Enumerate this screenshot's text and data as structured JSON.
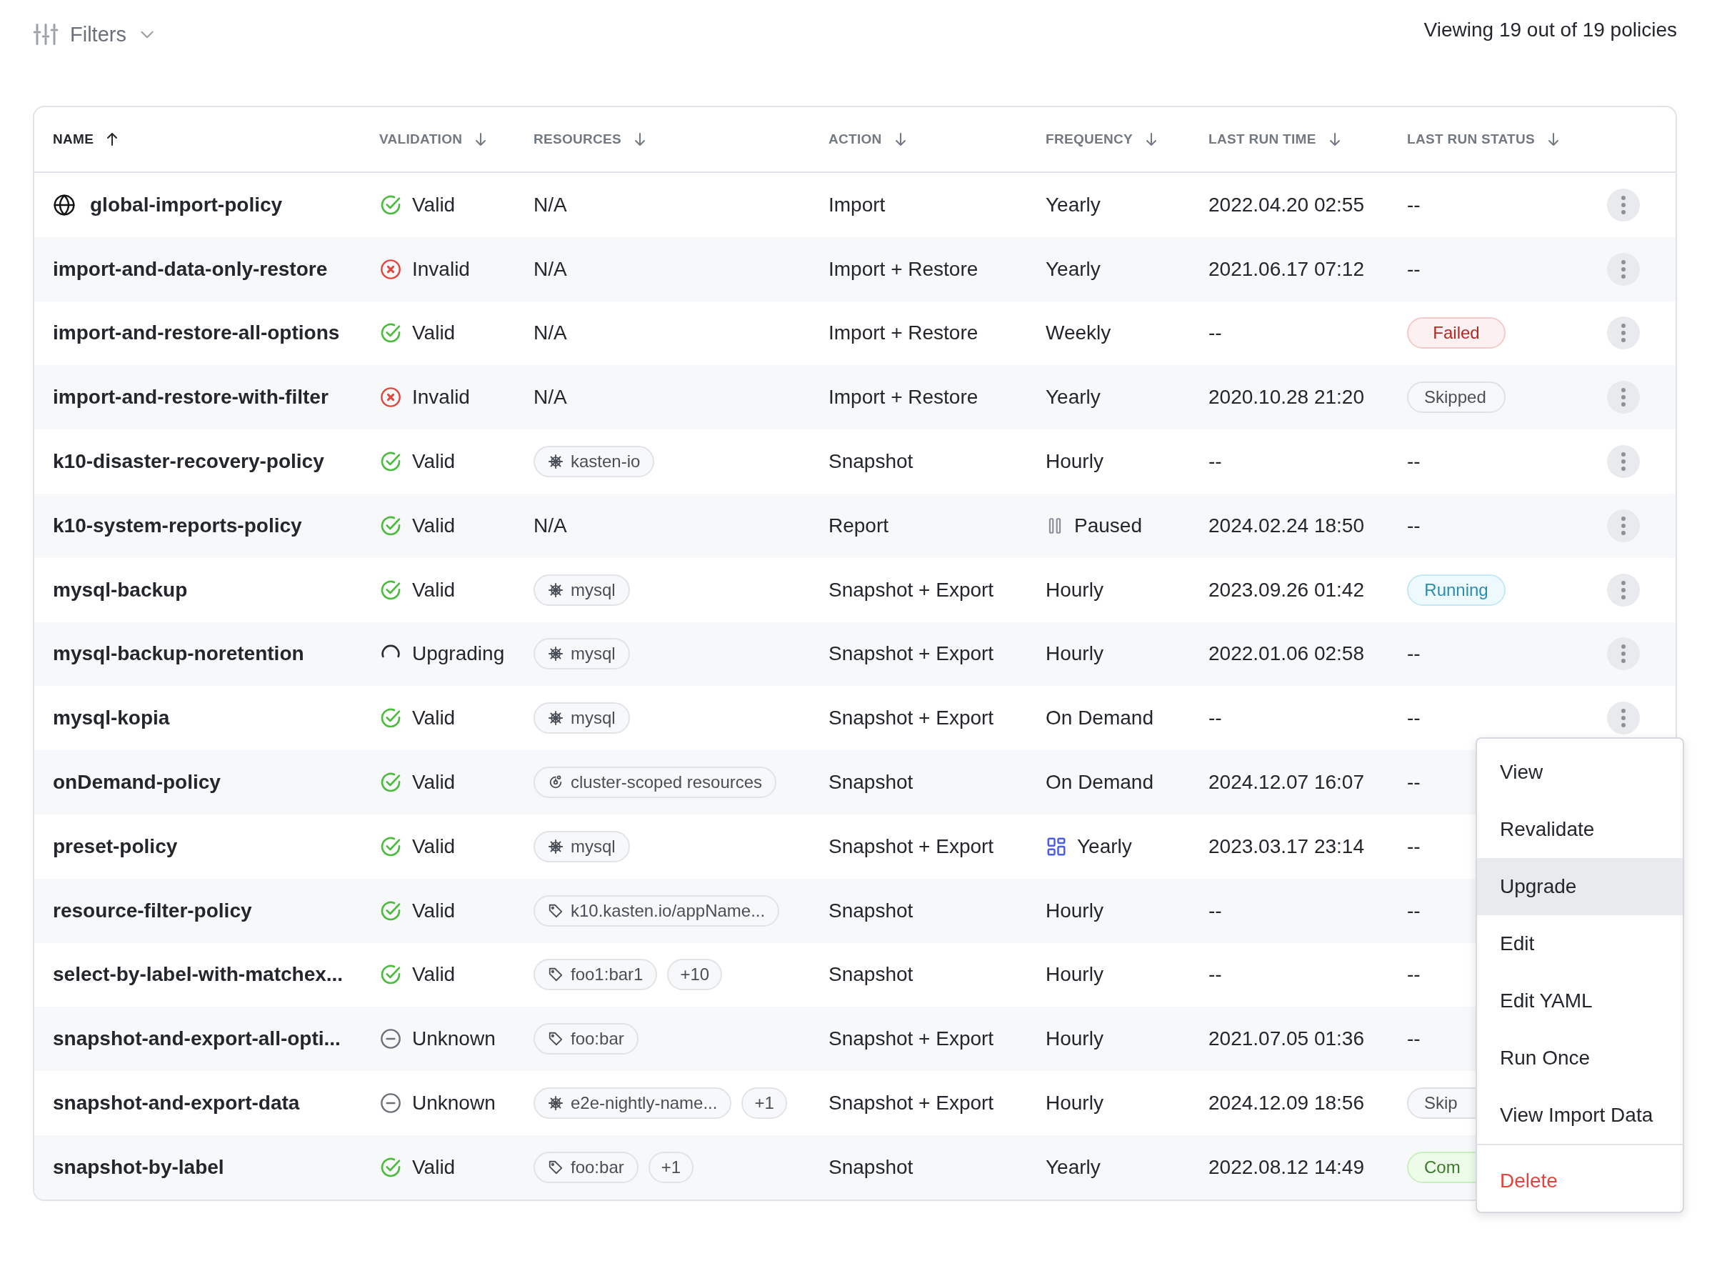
{
  "toolbar": {
    "filter_label": "Filters",
    "summary": "Viewing 19 out of 19 policies"
  },
  "table": {
    "columns": [
      {
        "label": "NAME",
        "selected": true,
        "ascending": true
      },
      {
        "label": "VALIDATION",
        "selected": false,
        "ascending": false
      },
      {
        "label": "RESOURCES",
        "selected": false,
        "ascending": false
      },
      {
        "label": "ACTION",
        "selected": false,
        "ascending": false
      },
      {
        "label": "FREQUENCY",
        "selected": false,
        "ascending": false
      },
      {
        "label": "LAST RUN TIME",
        "selected": false,
        "ascending": false
      },
      {
        "label": "LAST RUN STATUS",
        "selected": false,
        "ascending": false
      }
    ],
    "rows": [
      {
        "name": "global-import-policy",
        "global": true,
        "validation": {
          "kind": "valid",
          "text": "Valid"
        },
        "resources_text": "N/A",
        "action": "Import",
        "frequency": {
          "kind": "plain",
          "text": "Yearly"
        },
        "last_run_time": "2022.04.20 02:55",
        "last_run_status": {
          "kind": "none",
          "text": "--"
        },
        "more_button": true
      },
      {
        "name": "import-and-data-only-restore",
        "global": false,
        "validation": {
          "kind": "invalid",
          "text": "Invalid"
        },
        "resources_text": "N/A",
        "action": "Import + Restore",
        "frequency": {
          "kind": "plain",
          "text": "Yearly"
        },
        "last_run_time": "2021.06.17 07:12",
        "last_run_status": {
          "kind": "none",
          "text": "--"
        },
        "more_button": true
      },
      {
        "name": "import-and-restore-all-options",
        "global": false,
        "validation": {
          "kind": "valid",
          "text": "Valid"
        },
        "resources_text": "N/A",
        "action": "Import + Restore",
        "frequency": {
          "kind": "plain",
          "text": "Weekly"
        },
        "last_run_time": "--",
        "last_run_status": {
          "kind": "failed",
          "text": "Failed"
        },
        "more_button": true
      },
      {
        "name": "import-and-restore-with-filter",
        "global": false,
        "validation": {
          "kind": "invalid",
          "text": "Invalid"
        },
        "resources_text": "N/A",
        "action": "Import + Restore",
        "frequency": {
          "kind": "plain",
          "text": "Yearly"
        },
        "last_run_time": "2020.10.28 21:20",
        "last_run_status": {
          "kind": "skipped",
          "text": "Skipped"
        },
        "more_button": true
      },
      {
        "name": "k10-disaster-recovery-policy",
        "global": false,
        "validation": {
          "kind": "valid",
          "text": "Valid"
        },
        "resources": [
          {
            "kind": "namespace",
            "text": "kasten-io"
          }
        ],
        "action": "Snapshot",
        "frequency": {
          "kind": "plain",
          "text": "Hourly"
        },
        "last_run_time": "--",
        "last_run_status": {
          "kind": "none",
          "text": "--"
        },
        "more_button": true
      },
      {
        "name": "k10-system-reports-policy",
        "global": false,
        "validation": {
          "kind": "valid",
          "text": "Valid"
        },
        "resources_text": "N/A",
        "action": "Report",
        "frequency": {
          "kind": "paused",
          "text": "Paused"
        },
        "last_run_time": "2024.02.24 18:50",
        "last_run_status": {
          "kind": "none",
          "text": "--"
        },
        "more_button": true
      },
      {
        "name": "mysql-backup",
        "global": false,
        "validation": {
          "kind": "valid",
          "text": "Valid"
        },
        "resources": [
          {
            "kind": "namespace",
            "text": "mysql"
          }
        ],
        "action": "Snapshot + Export",
        "frequency": {
          "kind": "plain",
          "text": "Hourly"
        },
        "last_run_time": "2023.09.26 01:42",
        "last_run_status": {
          "kind": "running",
          "text": "Running"
        },
        "more_button": true
      },
      {
        "name": "mysql-backup-noretention",
        "global": false,
        "validation": {
          "kind": "upgrading",
          "text": "Upgrading"
        },
        "resources": [
          {
            "kind": "namespace",
            "text": "mysql"
          }
        ],
        "action": "Snapshot + Export",
        "frequency": {
          "kind": "plain",
          "text": "Hourly"
        },
        "last_run_time": "2022.01.06 02:58",
        "last_run_status": {
          "kind": "none",
          "text": "--"
        },
        "more_button": true
      },
      {
        "name": "mysql-kopia",
        "global": false,
        "validation": {
          "kind": "valid",
          "text": "Valid"
        },
        "resources": [
          {
            "kind": "namespace",
            "text": "mysql"
          }
        ],
        "action": "Snapshot + Export",
        "frequency": {
          "kind": "plain",
          "text": "On Demand"
        },
        "last_run_time": "--",
        "last_run_status": {
          "kind": "none",
          "text": "--"
        },
        "more_button": true
      },
      {
        "name": "onDemand-policy",
        "global": false,
        "validation": {
          "kind": "valid",
          "text": "Valid"
        },
        "resources": [
          {
            "kind": "cluster",
            "text": "cluster-scoped resources"
          }
        ],
        "action": "Snapshot",
        "frequency": {
          "kind": "plain",
          "text": "On Demand"
        },
        "last_run_time": "2024.12.07 16:07",
        "last_run_status": {
          "kind": "none",
          "text": "--"
        },
        "more_button": false
      },
      {
        "name": "preset-policy",
        "global": false,
        "validation": {
          "kind": "valid",
          "text": "Valid"
        },
        "resources": [
          {
            "kind": "namespace",
            "text": "mysql"
          }
        ],
        "action": "Snapshot + Export",
        "frequency": {
          "kind": "preset",
          "text": "Yearly"
        },
        "last_run_time": "2023.03.17 23:14",
        "last_run_status": {
          "kind": "none",
          "text": "--"
        },
        "more_button": false
      },
      {
        "name": "resource-filter-policy",
        "global": false,
        "validation": {
          "kind": "valid",
          "text": "Valid"
        },
        "resources": [
          {
            "kind": "label",
            "text": "k10.kasten.io/appName..."
          }
        ],
        "action": "Snapshot",
        "frequency": {
          "kind": "plain",
          "text": "Hourly"
        },
        "last_run_time": "--",
        "last_run_status": {
          "kind": "none",
          "text": "--"
        },
        "more_button": false
      },
      {
        "name": "select-by-label-with-matchex...",
        "global": false,
        "validation": {
          "kind": "valid",
          "text": "Valid"
        },
        "resources": [
          {
            "kind": "label",
            "text": "foo1:bar1"
          },
          {
            "kind": "count",
            "text": "+10"
          }
        ],
        "action": "Snapshot",
        "frequency": {
          "kind": "plain",
          "text": "Hourly"
        },
        "last_run_time": "--",
        "last_run_status": {
          "kind": "none",
          "text": "--"
        },
        "more_button": false
      },
      {
        "name": "snapshot-and-export-all-opti...",
        "global": false,
        "validation": {
          "kind": "unknown",
          "text": "Unknown"
        },
        "resources": [
          {
            "kind": "label",
            "text": "foo:bar"
          }
        ],
        "action": "Snapshot + Export",
        "frequency": {
          "kind": "plain",
          "text": "Hourly"
        },
        "last_run_time": "2021.07.05 01:36",
        "last_run_status": {
          "kind": "none",
          "text": "--"
        },
        "more_button": false
      },
      {
        "name": "snapshot-and-export-data",
        "global": false,
        "validation": {
          "kind": "unknown",
          "text": "Unknown"
        },
        "resources": [
          {
            "kind": "namespace",
            "text": "e2e-nightly-name..."
          },
          {
            "kind": "count",
            "text": "+1"
          }
        ],
        "action": "Snapshot + Export",
        "frequency": {
          "kind": "plain",
          "text": "Hourly"
        },
        "last_run_time": "2024.12.09 18:56",
        "last_run_status": {
          "kind": "skipped",
          "text": "Skip"
        },
        "more_button": false
      },
      {
        "name": "snapshot-by-label",
        "global": false,
        "validation": {
          "kind": "valid",
          "text": "Valid"
        },
        "resources": [
          {
            "kind": "label",
            "text": "foo:bar"
          },
          {
            "kind": "count",
            "text": "+1"
          }
        ],
        "action": "Snapshot",
        "frequency": {
          "kind": "plain",
          "text": "Yearly"
        },
        "last_run_time": "2022.08.12 14:49",
        "last_run_status": {
          "kind": "completed",
          "text": "Com"
        },
        "more_button": false
      }
    ]
  },
  "context_menu": {
    "items": [
      {
        "label": "View",
        "kind": "normal",
        "selected": false
      },
      {
        "label": "Revalidate",
        "kind": "normal",
        "selected": false
      },
      {
        "label": "Upgrade",
        "kind": "normal",
        "selected": true
      },
      {
        "label": "Edit",
        "kind": "normal",
        "selected": false
      },
      {
        "label": "Edit YAML",
        "kind": "normal",
        "selected": false
      },
      {
        "label": "Run Once",
        "kind": "normal",
        "selected": false
      },
      {
        "label": "View Import Data",
        "kind": "normal",
        "selected": false
      },
      {
        "label": "Delete",
        "kind": "danger",
        "selected": false
      }
    ]
  }
}
